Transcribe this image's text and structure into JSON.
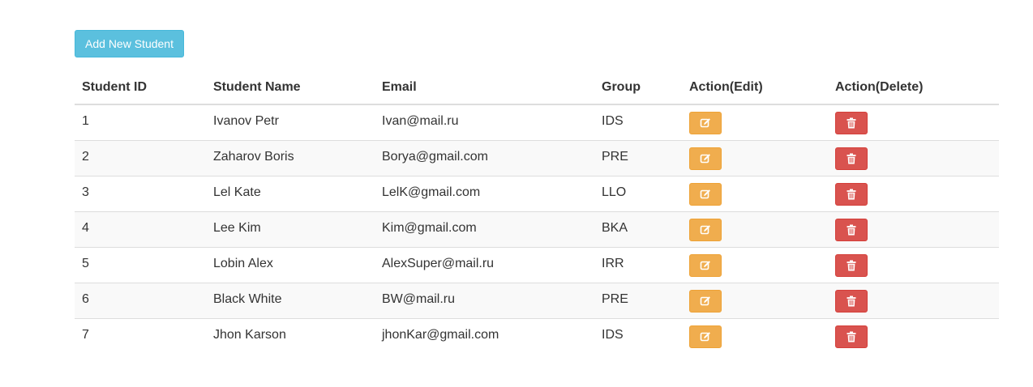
{
  "toolbar": {
    "add_label": "Add New Student"
  },
  "table": {
    "columns": [
      "Student ID",
      "Student Name",
      "Email",
      "Group",
      "Action(Edit)",
      "Action(Delete)"
    ],
    "rows": [
      {
        "id": "1",
        "name": "Ivanov Petr",
        "email": "Ivan@mail.ru",
        "group": "IDS"
      },
      {
        "id": "2",
        "name": "Zaharov Boris",
        "email": "Borya@gmail.com",
        "group": "PRE"
      },
      {
        "id": "3",
        "name": "Lel Kate",
        "email": "LelK@gmail.com",
        "group": "LLO"
      },
      {
        "id": "4",
        "name": "Lee Kim",
        "email": "Kim@gmail.com",
        "group": "BKA"
      },
      {
        "id": "5",
        "name": "Lobin Alex",
        "email": "AlexSuper@mail.ru",
        "group": "IRR"
      },
      {
        "id": "6",
        "name": "Black White",
        "email": "BW@mail.ru",
        "group": "PRE"
      },
      {
        "id": "7",
        "name": "Jhon Karson",
        "email": "jhonKar@gmail.com",
        "group": "IDS"
      }
    ]
  },
  "icons": {
    "edit": "edit-icon",
    "delete": "trash-icon"
  },
  "colors": {
    "add_button": "#5bc0de",
    "edit_button": "#f0ad4e",
    "delete_button": "#d9534f",
    "stripe": "#f9f9f9"
  }
}
